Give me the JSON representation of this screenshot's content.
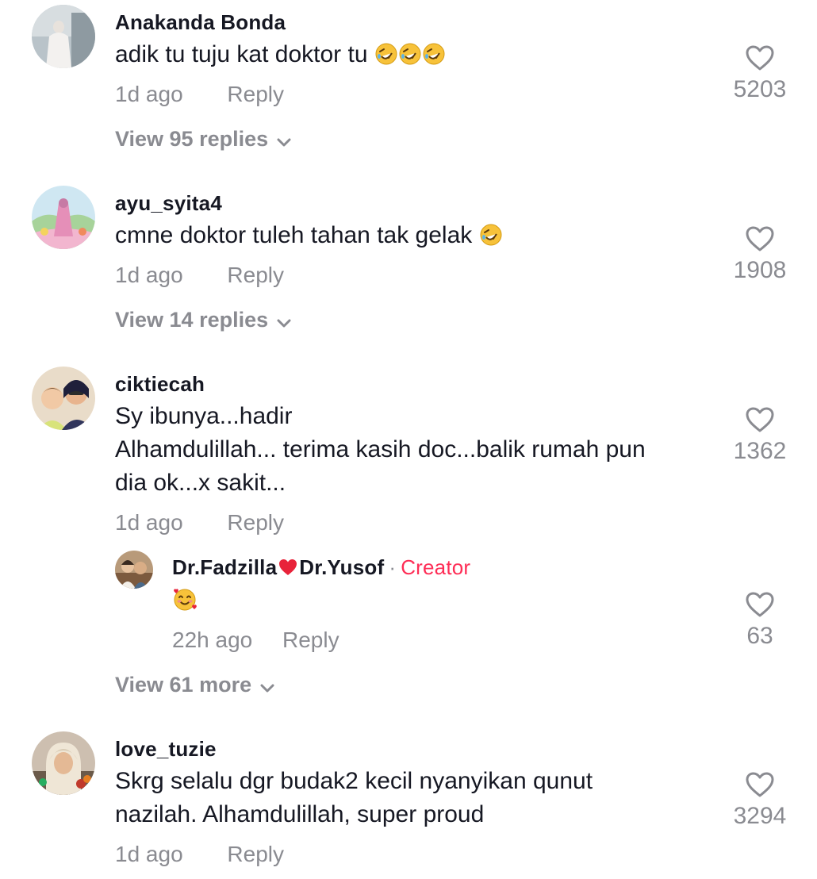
{
  "comments": [
    {
      "username": "Anakanda Bonda",
      "text": "adik tu tuju kat doktor tu",
      "emoji_icon": "rolling-on-floor-laughing-emoji",
      "emoji_count": 3,
      "time": "1d ago",
      "reply_label": "Reply",
      "likes": "5203",
      "view_replies": "View 95 replies"
    },
    {
      "username": "ayu_syita4",
      "text": "cmne doktor tuleh tahan tak gelak",
      "emoji_icon": "rolling-on-floor-laughing-emoji",
      "emoji_count": 1,
      "time": "1d ago",
      "reply_label": "Reply",
      "likes": "1908",
      "view_replies": "View 14 replies"
    },
    {
      "username": "ciktiecah",
      "text_lines": [
        "Sy ibunya...hadir",
        "Alhamdulillah... terima kasih doc...balik rumah pun",
        "dia ok...x sakit..."
      ],
      "time": "1d ago",
      "reply_label": "Reply",
      "likes": "1362",
      "view_replies": "View 61 more",
      "reply": {
        "username_part1": "Dr.Fadzilla",
        "username_heart_icon": "red-heart-emoji",
        "username_part2": "Dr.Yusof",
        "separator": "·",
        "creator_label": "Creator",
        "emoji_icon": "smiling-face-with-hearts-emoji",
        "time": "22h ago",
        "reply_label": "Reply",
        "likes": "63"
      }
    },
    {
      "username": "love_tuzie",
      "text_lines": [
        "Skrg selalu dgr budak2 kecil nyanyikan qunut",
        "nazilah. Alhamdulillah, super proud"
      ],
      "time": "1d ago",
      "reply_label": "Reply",
      "likes": "3294"
    }
  ],
  "colors": {
    "username": "#161823",
    "text": "#161823",
    "muted": "#8a8b91",
    "creator": "#fe2c55",
    "heart_outline": "#8a8b91"
  }
}
